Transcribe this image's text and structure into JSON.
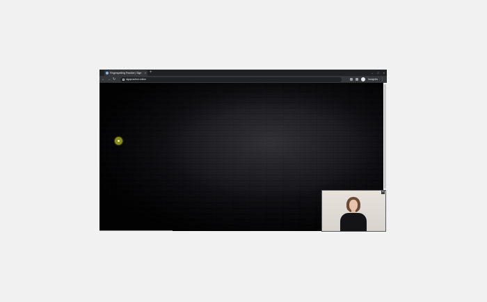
{
  "browser": {
    "tab_title": "Fingerspelling Practice | Sign",
    "tab_close": "×",
    "new_tab": "+",
    "window_controls": [
      "–",
      "□",
      "×"
    ],
    "url": "signpractice.online",
    "profile_label": "Incognito",
    "menu_symbol": "⋮",
    "nav": {
      "back": "←",
      "forward": "→",
      "reload": "↻"
    }
  },
  "webcam_overlay": {
    "close_symbol": "×"
  },
  "colors": {
    "page_background": "#f1f1f1",
    "browser_chrome": "#202124",
    "toolbar": "#35363a",
    "viewport": "#0c0c10",
    "cursor_highlight": "#8a8a1e"
  },
  "icons": [
    "tab-favicon-icon",
    "close-icon",
    "new-tab-icon",
    "back-arrow-icon",
    "forward-arrow-icon",
    "reload-icon",
    "lock-icon",
    "extension-icon",
    "profile-avatar-icon",
    "kebab-menu-icon"
  ]
}
